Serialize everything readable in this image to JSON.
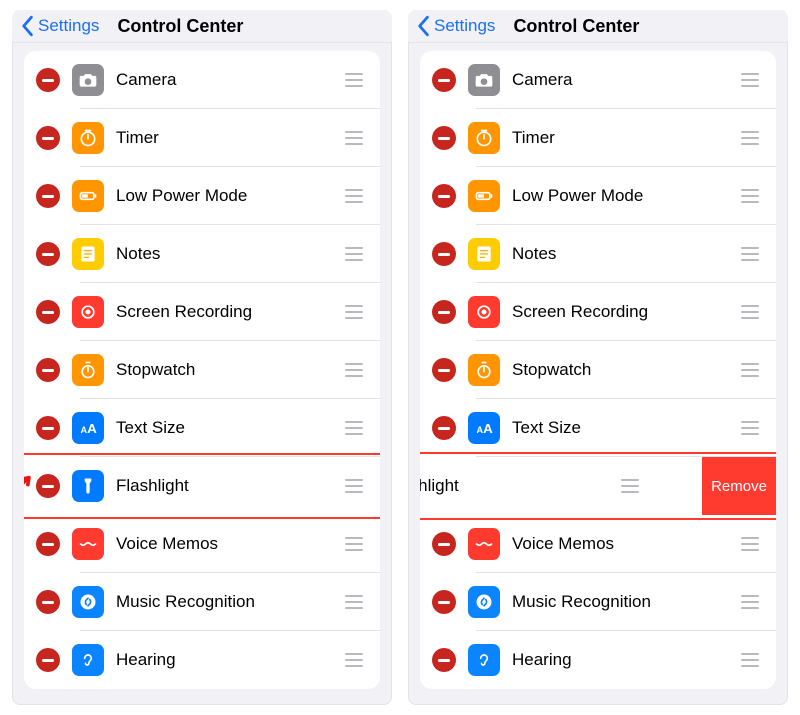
{
  "nav": {
    "back": "Settings",
    "title": "Control Center"
  },
  "items": [
    {
      "label": "Camera",
      "icon": "camera",
      "colorClass": "bg-gray"
    },
    {
      "label": "Timer",
      "icon": "timer",
      "colorClass": "bg-orange"
    },
    {
      "label": "Low Power Mode",
      "icon": "battery",
      "colorClass": "bg-orange"
    },
    {
      "label": "Notes",
      "icon": "notes",
      "colorClass": "bg-yellow"
    },
    {
      "label": "Screen Recording",
      "icon": "record",
      "colorClass": "bg-red"
    },
    {
      "label": "Stopwatch",
      "icon": "stopwatch",
      "colorClass": "bg-orange"
    },
    {
      "label": "Text Size",
      "icon": "textsize",
      "colorClass": "bg-blue"
    },
    {
      "label": "Flashlight",
      "icon": "flashlight",
      "colorClass": "bg-blue"
    },
    {
      "label": "Voice Memos",
      "icon": "voice",
      "colorClass": "bg-red"
    },
    {
      "label": "Music Recognition",
      "icon": "shazam",
      "colorClass": "bg-blue2"
    },
    {
      "label": "Hearing",
      "icon": "ear",
      "colorClass": "bg-blue2"
    }
  ],
  "swipe": {
    "highlightIndex": 7,
    "removeLabel": "Remove",
    "swipedLabel": "Flashlight"
  }
}
